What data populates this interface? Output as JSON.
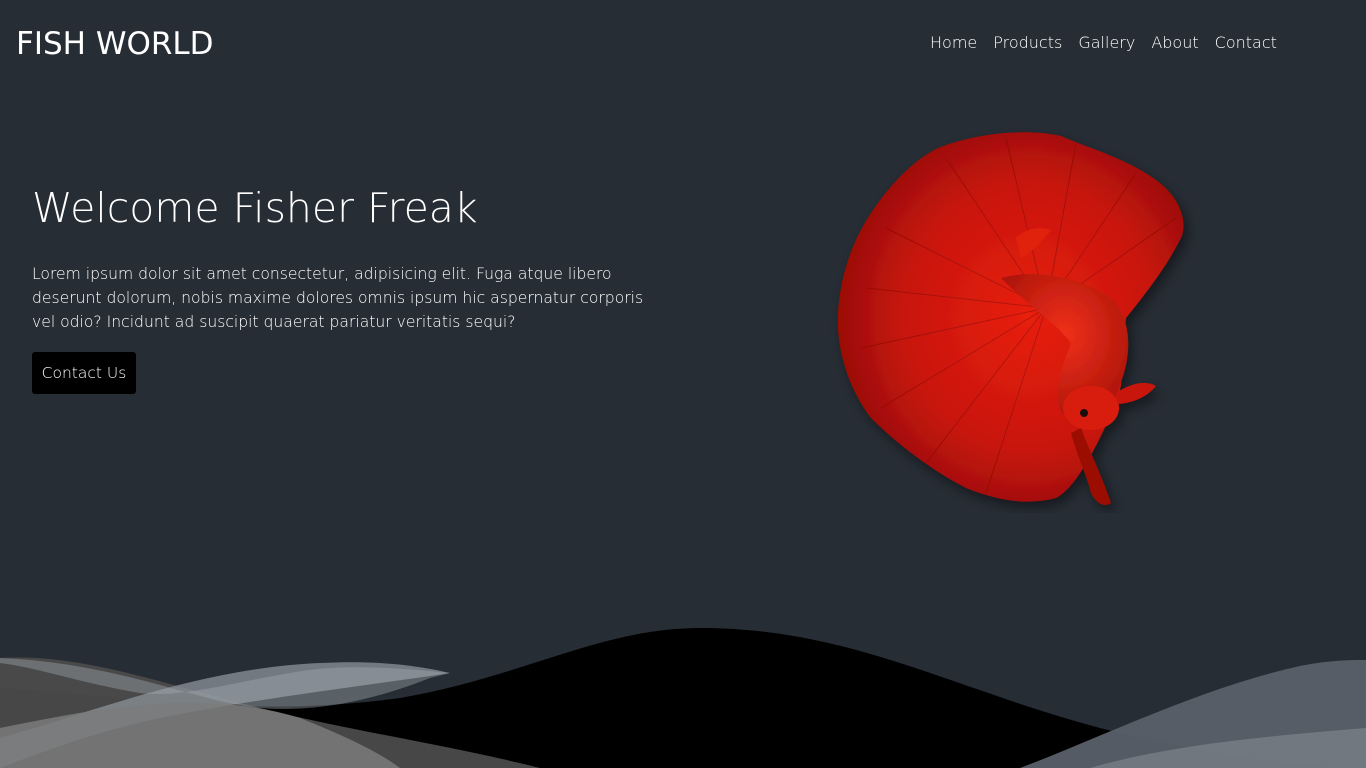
{
  "header": {
    "logo": "FISH WORLD",
    "nav": [
      {
        "label": "Home"
      },
      {
        "label": "Products"
      },
      {
        "label": "Gallery"
      },
      {
        "label": "About"
      },
      {
        "label": "Contact"
      }
    ]
  },
  "hero": {
    "title": "Welcome Fisher Freak",
    "text": "Lorem ipsum dolor sit amet consectetur, adipisicing elit. Fuga atque libero deserunt dolorum, nobis maxime dolores omnis ipsum hic aspernatur corporis vel odio? Incidunt ad suscipit quaerat pariatur veritatis sequi?",
    "button_label": "Contact Us",
    "image": "red-betta-fish"
  },
  "colors": {
    "background": "#272d35",
    "button": "#000000",
    "fish": "#d41608",
    "waves": [
      "#000000",
      "#4a4d52",
      "#8a9097"
    ]
  }
}
